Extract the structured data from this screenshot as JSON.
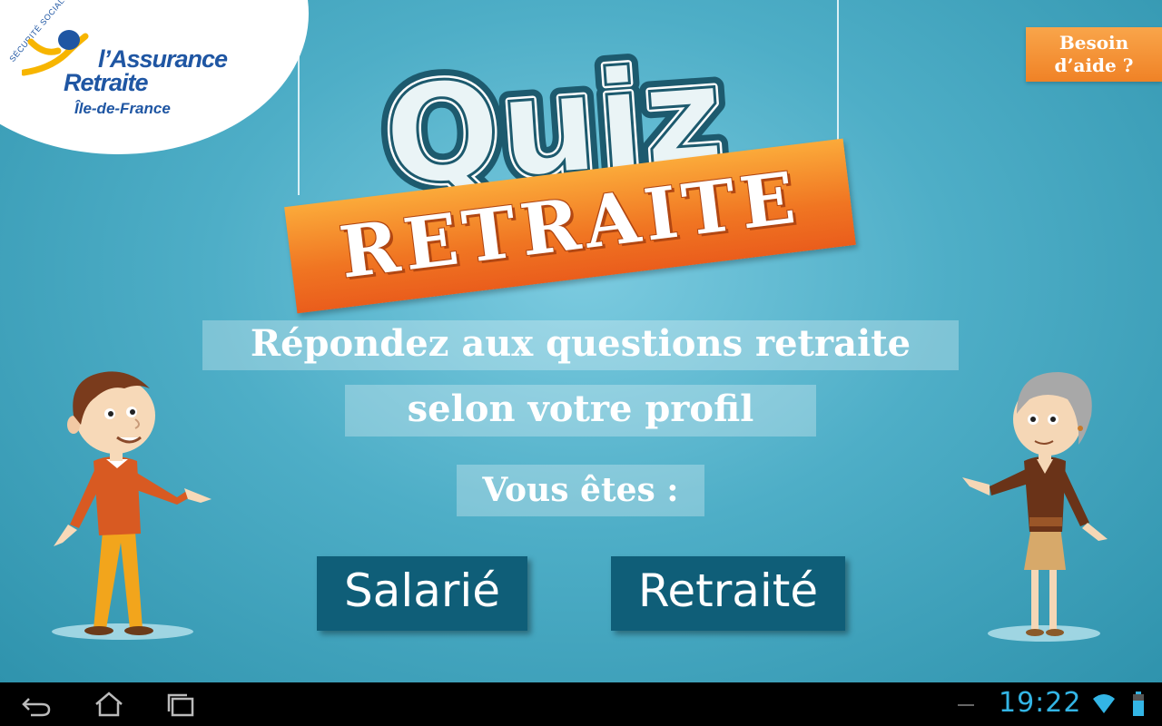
{
  "logo": {
    "org": "SÉCURITÉ SOCIALE",
    "line1": "l’Assurance",
    "line2": "Retraite",
    "line3": "Île-de-France"
  },
  "help_button": {
    "line1": "Besoin",
    "line2": "d’aide ?"
  },
  "title": {
    "word1": "Quiz",
    "word2": "RETRAITE"
  },
  "intro": {
    "line1": "Répondez aux questions retraite",
    "line2": "selon votre profil",
    "prompt": "Vous êtes :"
  },
  "choices": [
    {
      "label": "Salarié"
    },
    {
      "label": "Retraité"
    }
  ],
  "status_bar": {
    "time": "19:22"
  },
  "colors": {
    "accent_orange": "#f08226",
    "button_dark_teal": "#0f5e78",
    "logo_blue": "#1f56a3",
    "clock_blue": "#33b5e5"
  },
  "icons": [
    "back-icon",
    "home-icon",
    "recent-apps-icon",
    "wifi-icon",
    "battery-icon"
  ]
}
